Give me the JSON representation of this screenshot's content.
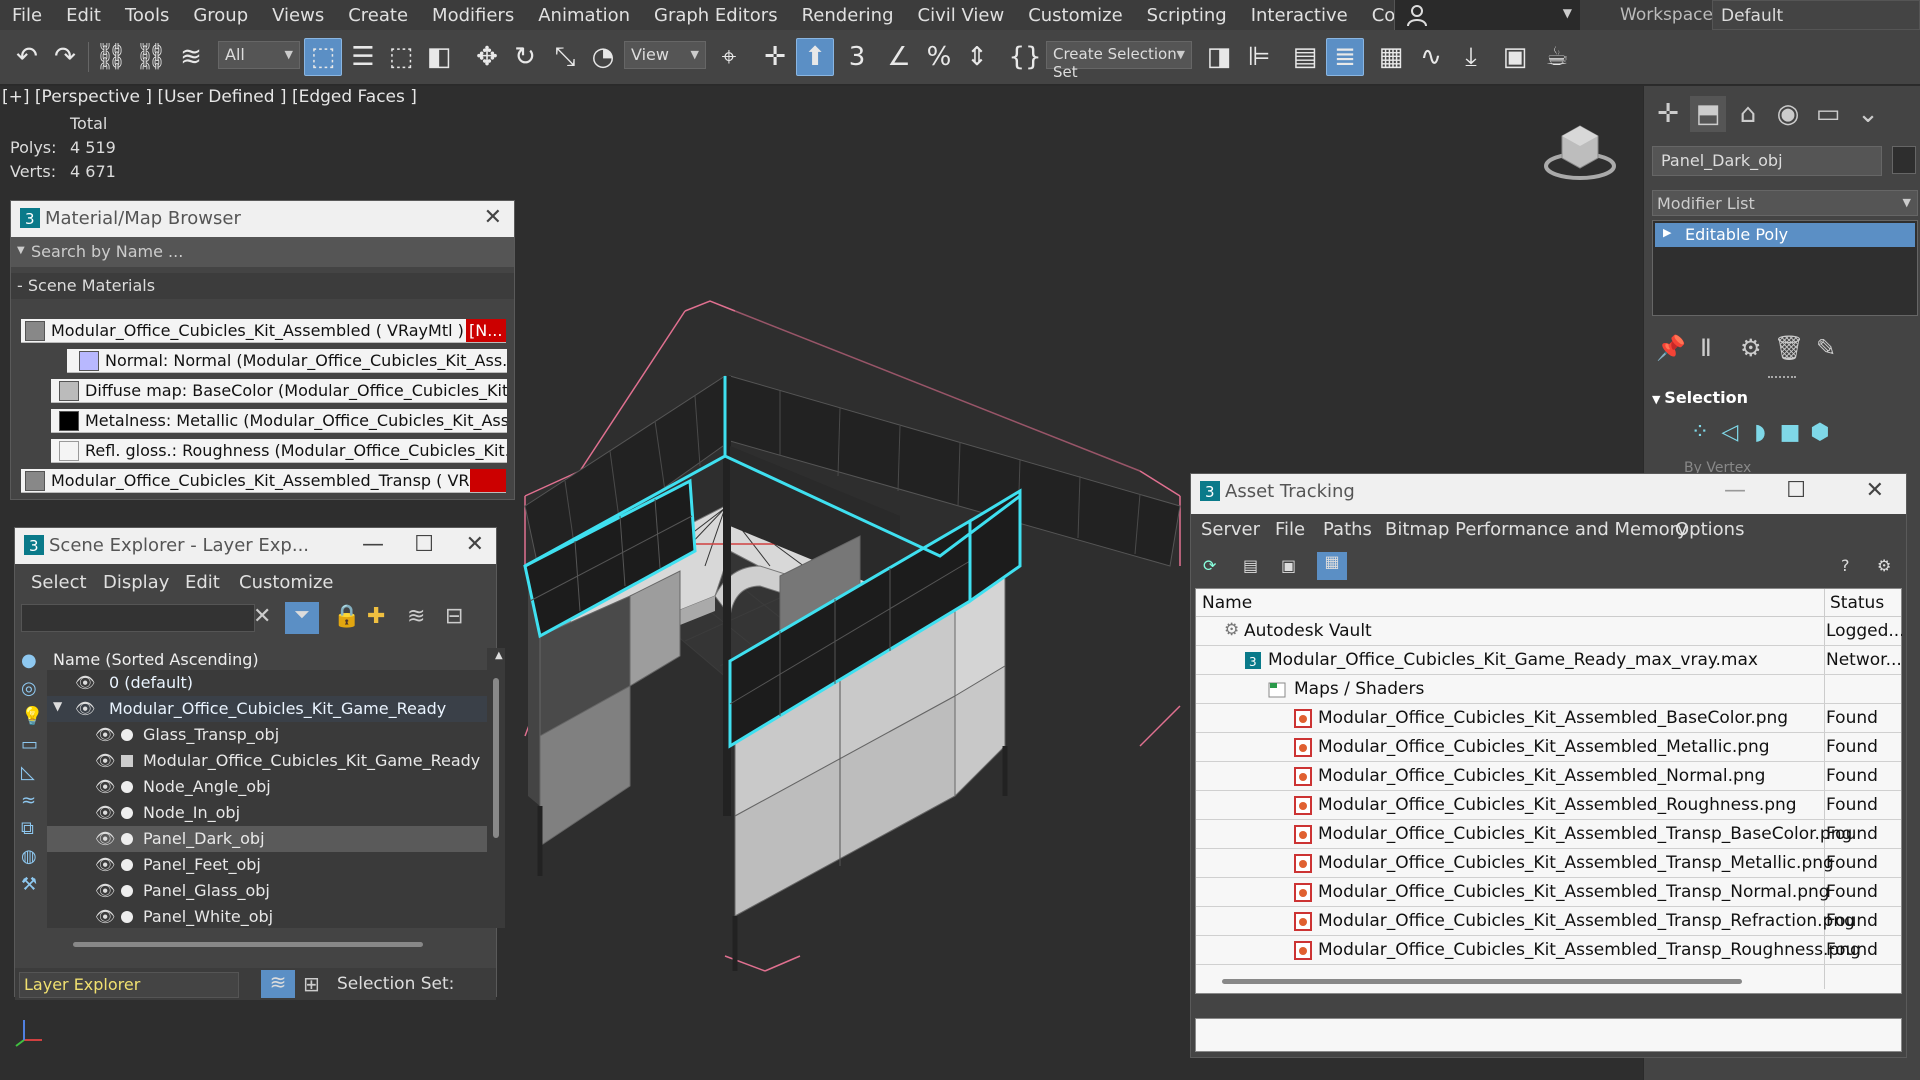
{
  "menubar": {
    "items": [
      "File",
      "Edit",
      "Tools",
      "Group",
      "Views",
      "Create",
      "Modifiers",
      "Animation",
      "Graph Editors",
      "Rendering",
      "Civil View",
      "Customize",
      "Scripting",
      "Interactive",
      "Content"
    ],
    "more": "»",
    "workspaces_label": "Workspaces:",
    "workspaces_value": "Default"
  },
  "toolbar": {
    "filter_value": "All",
    "refcoord_value": "View",
    "selection_set_placeholder": "Create Selection Set",
    "spinner_label": "3"
  },
  "viewport": {
    "label": "[+] [Perspective ] [User Defined ] [Edged Faces ]",
    "stats": {
      "total_label": "Total",
      "polys_label": "Polys:",
      "polys_value": "4 519",
      "verts_label": "Verts:",
      "verts_value": "4 671"
    }
  },
  "command_panel": {
    "object_name": "Panel_Dark_obj",
    "modifier_list_label": "Modifier List",
    "stack_item": "Editable Poly",
    "selection_rollout": "Selection",
    "by_vertex": "By Vertex"
  },
  "material_browser": {
    "title": "Material/Map Browser",
    "search_placeholder": "Search by Name ...",
    "section": "Scene Materials",
    "rows": [
      {
        "text": "Modular_Office_Cubicles_Kit_Assembled  ( VRayMtl )",
        "tag": "[N..."
      },
      {
        "text": "Normal:  Normal  (Modular_Office_Cubicles_Kit_Ass..."
      },
      {
        "text": "Diffuse  map:  BaseColor  (Modular_Office_Cubicles_Kit..."
      },
      {
        "text": "Metalness:  Metallic  (Modular_Office_Cubicles_Kit_Ass..."
      },
      {
        "text": "Refl.  gloss.:  Roughness  (Modular_Office_Cubicles_Kit..."
      },
      {
        "text": "Modular_Office_Cubicles_Kit_Assembled_Transp   ( VRay...",
        "tag": ""
      }
    ]
  },
  "scene_explorer": {
    "title": "Scene Explorer - Layer Exp...",
    "menu": [
      "Select",
      "Display",
      "Edit",
      "Customize"
    ],
    "column_header": "Name (Sorted Ascending)",
    "rows": [
      {
        "label": "0 (default)",
        "kind": "layer"
      },
      {
        "label": "Modular_Office_Cubicles_Kit_Game_Ready",
        "kind": "layer-open"
      },
      {
        "label": "Glass_Transp_obj",
        "kind": "obj"
      },
      {
        "label": "Modular_Office_Cubicles_Kit_Game_Ready",
        "kind": "obj"
      },
      {
        "label": "Node_Angle_obj",
        "kind": "obj"
      },
      {
        "label": "Node_In_obj",
        "kind": "obj"
      },
      {
        "label": "Panel_Dark_obj",
        "kind": "obj-selected"
      },
      {
        "label": "Panel_Feet_obj",
        "kind": "obj"
      },
      {
        "label": "Panel_Glass_obj",
        "kind": "obj"
      },
      {
        "label": "Panel_White_obj",
        "kind": "obj"
      }
    ],
    "footer_explorer": "Layer Explorer",
    "footer_selection_set": "Selection Set:"
  },
  "asset_tracking": {
    "title": "Asset Tracking",
    "menu": [
      "Server",
      "File",
      "Paths",
      "Bitmap Performance and Memory",
      "Options"
    ],
    "columns": {
      "name": "Name",
      "status": "Status"
    },
    "rows": [
      {
        "name": "Autodesk Vault",
        "status": "Logged...",
        "indent": 0
      },
      {
        "name": "Modular_Office_Cubicles_Kit_Game_Ready_max_vray.max",
        "status": "Networ...",
        "indent": 1
      },
      {
        "name": "Maps / Shaders",
        "status": "",
        "indent": 2
      },
      {
        "name": "Modular_Office_Cubicles_Kit_Assembled_BaseColor.png",
        "status": "Found",
        "indent": 3
      },
      {
        "name": "Modular_Office_Cubicles_Kit_Assembled_Metallic.png",
        "status": "Found",
        "indent": 3
      },
      {
        "name": "Modular_Office_Cubicles_Kit_Assembled_Normal.png",
        "status": "Found",
        "indent": 3
      },
      {
        "name": "Modular_Office_Cubicles_Kit_Assembled_Roughness.png",
        "status": "Found",
        "indent": 3
      },
      {
        "name": "Modular_Office_Cubicles_Kit_Assembled_Transp_BaseColor.png",
        "status": "Found",
        "indent": 3
      },
      {
        "name": "Modular_Office_Cubicles_Kit_Assembled_Transp_Metallic.png",
        "status": "Found",
        "indent": 3
      },
      {
        "name": "Modular_Office_Cubicles_Kit_Assembled_Transp_Normal.png",
        "status": "Found",
        "indent": 3
      },
      {
        "name": "Modular_Office_Cubicles_Kit_Assembled_Transp_Refraction.png",
        "status": "Found",
        "indent": 3
      },
      {
        "name": "Modular_Office_Cubicles_Kit_Assembled_Transp_Roughness.png",
        "status": "Found",
        "indent": 3
      }
    ]
  },
  "colors": {
    "accent": "#5b8fc5",
    "selection_cyan": "#3fe0f0",
    "stats_yellow": "#f0e070",
    "material_red": "#cc0000"
  }
}
